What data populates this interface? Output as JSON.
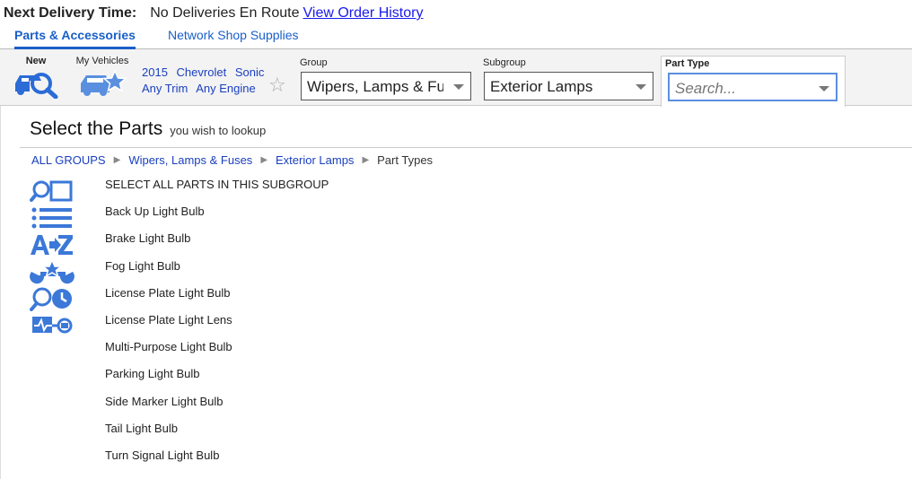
{
  "header": {
    "delivery_label": "Next Delivery Time:",
    "delivery_value": "No Deliveries En Route",
    "order_history_link": "View Order History"
  },
  "tabs": [
    {
      "label": "Parts & Accessories",
      "active": true
    },
    {
      "label": "Network Shop Supplies",
      "active": false
    }
  ],
  "vehicle": {
    "new_label": "New",
    "my_vehicles_label": "My Vehicles",
    "year": "2015",
    "make": "Chevrolet",
    "model": "Sonic",
    "trim": "Any Trim",
    "engine": "Any Engine"
  },
  "selectors": {
    "group_label": "Group",
    "group_value": "Wipers, Lamps & Fuses",
    "subgroup_label": "Subgroup",
    "subgroup_value": "Exterior Lamps",
    "parttype_label": "Part Type",
    "parttype_placeholder": "Search..."
  },
  "main": {
    "title": "Select the Parts",
    "subtitle": "you wish to lookup",
    "breadcrumb": [
      "ALL GROUPS",
      "Wipers, Lamps & Fuses",
      "Exterior Lamps",
      "Part Types"
    ],
    "parts": [
      "SELECT ALL PARTS IN THIS SUBGROUP",
      "Back Up Light Bulb",
      "Brake Light Bulb",
      "Fog Light Bulb",
      "License Plate Light Bulb",
      "License Plate Light Lens",
      "Multi-Purpose Light Bulb",
      "Parking Light Bulb",
      "Side Marker Light Bulb",
      "Tail Light Bulb",
      "Turn Signal Light Bulb"
    ]
  },
  "colors": {
    "accent": "#1a5fc8",
    "icon_blue": "#3b78d8",
    "link": "#1a3fbf"
  },
  "side_icons": [
    "search-parts-icon",
    "list-view-icon",
    "a-to-z-icon",
    "tools-star-icon",
    "search-history-icon",
    "diagnostics-icon"
  ]
}
